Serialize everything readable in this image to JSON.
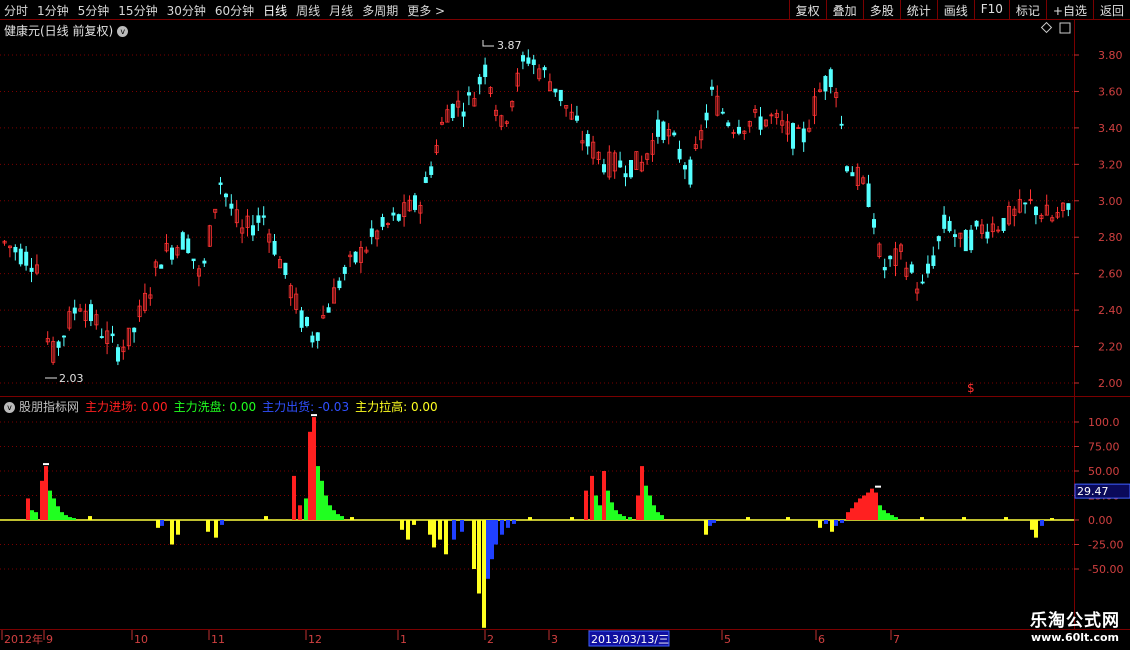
{
  "toolbar": {
    "periods": [
      "分时",
      "1分钟",
      "5分钟",
      "15分钟",
      "30分钟",
      "60分钟",
      "日线",
      "周线",
      "月线",
      "多周期",
      "更多 >"
    ],
    "active_period": "日线",
    "actions": [
      "复权",
      "叠加",
      "多股",
      "统计",
      "画线",
      "F10",
      "标记",
      "+自选",
      "返回"
    ]
  },
  "main_panel": {
    "title": "健康元(日线 前复权)",
    "high_label": "3.87",
    "low_label": "2.03",
    "price_axis": [
      "3.80",
      "3.60",
      "3.40",
      "3.20",
      "3.00",
      "2.80",
      "2.60",
      "2.40",
      "2.20",
      "2.00"
    ],
    "marker": "$"
  },
  "indicator_panel": {
    "name": "股朋指标网",
    "items": [
      {
        "label": "主力进场:",
        "value": "0.00",
        "color": "#ff2020"
      },
      {
        "label": "主力洗盘:",
        "value": "0.00",
        "color": "#20ff20"
      },
      {
        "label": "主力出货:",
        "value": "-0.03",
        "color": "#3050ff"
      },
      {
        "label": "主力拉高:",
        "value": "0.00",
        "color": "#ffff20"
      }
    ],
    "axis": [
      "100.0",
      "75.00",
      "50.00",
      "25.00",
      "0.00",
      "-25.00",
      "-50.00"
    ],
    "current_value": "29.47"
  },
  "date_axis": {
    "labels": [
      "2012年",
      "9",
      "10",
      "11",
      "12",
      "1",
      "2",
      "3",
      "2013/03/13/三",
      "5",
      "6",
      "7"
    ]
  },
  "watermark": {
    "title": "乐淘公式网",
    "url": "www.60lt.com"
  },
  "colors": {
    "up": "#ff3232",
    "down": "#54ffff",
    "grid": "#7a0000"
  }
}
